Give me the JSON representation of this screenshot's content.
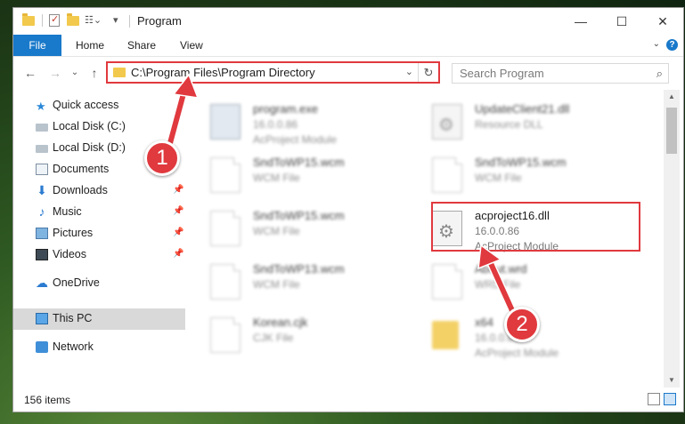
{
  "window": {
    "title": "Program",
    "controls": {
      "minimize": "—",
      "maximize": "☐",
      "close": "✕"
    }
  },
  "ribbon": {
    "tabs": [
      "File",
      "Home",
      "Share",
      "View"
    ],
    "help": "?"
  },
  "addressbar": {
    "path": "C:\\Program Files\\Program Directory",
    "dropdown": "⌄",
    "refresh": "↻"
  },
  "search": {
    "placeholder": "Search Program",
    "icon": "⌕"
  },
  "nav": {
    "back": "←",
    "forward": "→",
    "recent": "⌄",
    "up": "↑"
  },
  "sidebar": {
    "items": [
      {
        "label": "Quick access",
        "icon": "star-icon",
        "pinned": false
      },
      {
        "label": "Local Disk (C:)",
        "icon": "disk-icon",
        "pinned": false
      },
      {
        "label": "Local Disk (D:)",
        "icon": "disk-icon",
        "pinned": false
      },
      {
        "label": "Documents",
        "icon": "documents-icon",
        "pinned": false
      },
      {
        "label": "Downloads",
        "icon": "download-icon",
        "pinned": true
      },
      {
        "label": "Music",
        "icon": "music-icon",
        "pinned": true
      },
      {
        "label": "Pictures",
        "icon": "pictures-icon",
        "pinned": true
      },
      {
        "label": "Videos",
        "icon": "videos-icon",
        "pinned": true
      },
      {
        "label": "OneDrive",
        "icon": "cloud-icon",
        "pinned": false
      },
      {
        "label": "This PC",
        "icon": "computer-icon",
        "pinned": false,
        "selected": true
      },
      {
        "label": "Network",
        "icon": "network-icon",
        "pinned": false
      }
    ]
  },
  "files": [
    {
      "name": "program.exe",
      "type": "16.0.0.86",
      "sub": "AcProject Module",
      "icon": "exe-icon",
      "blurred": true
    },
    {
      "name": "UpdateClient21.dll",
      "type": "Resource DLL",
      "sub": "",
      "icon": "gear-page-icon",
      "blurred": true
    },
    {
      "name": "SndToWP15.wcm",
      "type": "WCM File",
      "sub": "",
      "icon": "page-icon",
      "blurred": true
    },
    {
      "name": "SndToWP15.wcm",
      "type": "WCM File",
      "sub": "",
      "icon": "page-icon",
      "blurred": true
    },
    {
      "name": "SndToWP15.wcm",
      "type": "WCM File",
      "sub": "",
      "icon": "page-icon",
      "blurred": true
    },
    {
      "name": "acproject16.dll",
      "type": "16.0.0.86",
      "sub": "AcProject Module",
      "icon": "gear-page-icon",
      "blurred": false
    },
    {
      "name": "SndToWP13.wcm",
      "type": "WCM File",
      "sub": "",
      "icon": "page-icon",
      "blurred": true
    },
    {
      "name": "About.wrd",
      "type": "WRD File",
      "sub": "",
      "icon": "page-icon",
      "blurred": true
    },
    {
      "name": "Korean.cjk",
      "type": "CJK File",
      "sub": "",
      "icon": "page-icon",
      "blurred": true
    },
    {
      "name": "x64",
      "type": "16.0.0.86",
      "sub": "AcProject Module",
      "icon": "folder-icon",
      "blurred": true
    }
  ],
  "status": {
    "items_count": "156 items"
  },
  "callouts": [
    {
      "label": "1"
    },
    {
      "label": "2"
    }
  ],
  "colors": {
    "accent": "#1979ca",
    "highlight": "#e0393e",
    "selected": "#d9d9d9"
  }
}
